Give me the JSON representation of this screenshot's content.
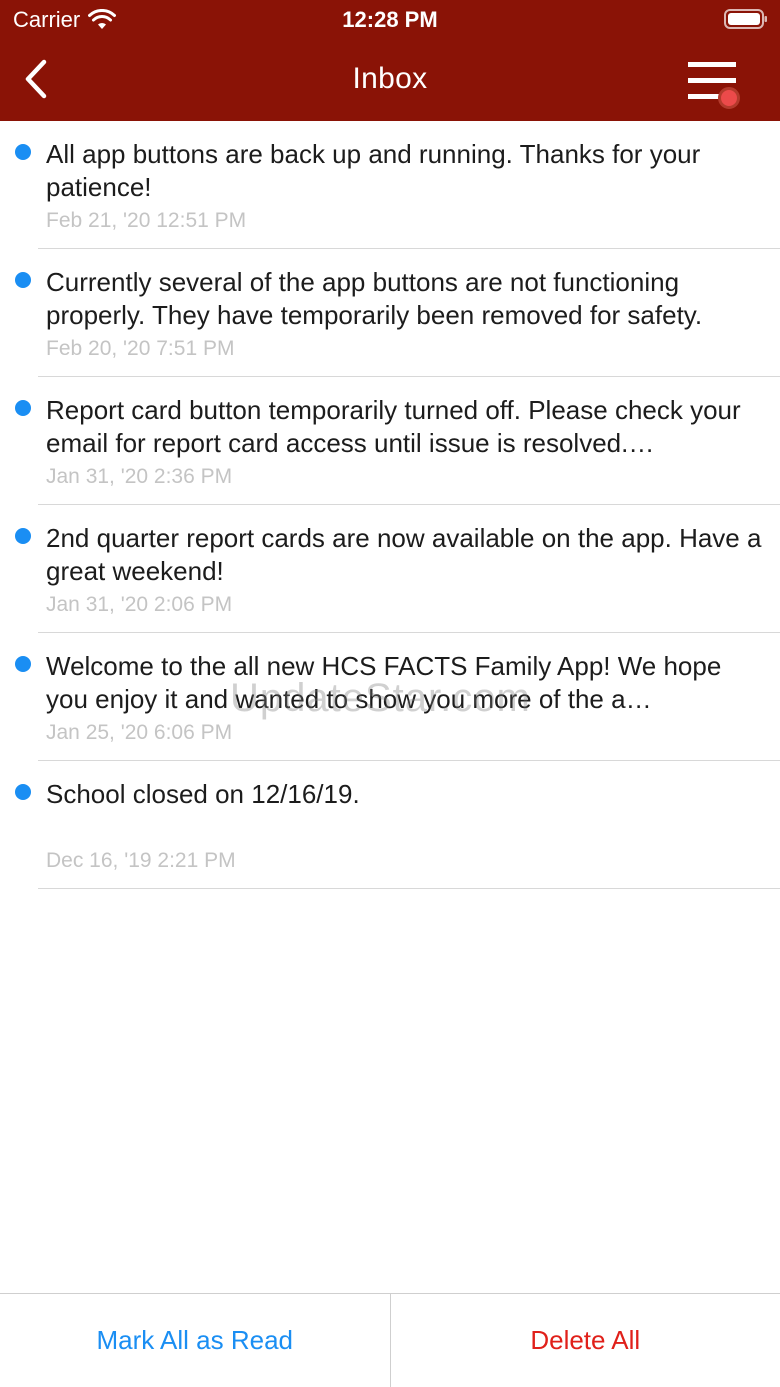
{
  "status_bar": {
    "carrier": "Carrier",
    "time": "12:28 PM",
    "wifi_icon": "wifi-icon",
    "battery_icon": "battery-full-icon"
  },
  "nav": {
    "title": "Inbox",
    "back_icon": "chevron-left-icon",
    "menu_icon": "hamburger-menu-icon",
    "notify_badge_color": "#ec4a4a",
    "background_color": "#8a1306"
  },
  "messages": [
    {
      "text": "All app buttons are back up and running.  Thanks for your patience!",
      "date": "Feb 21, '20 12:51 PM",
      "unread": true
    },
    {
      "text": "Currently several of the app buttons are not functioning properly.  They have temporarily been removed for safety.",
      "date": "Feb 20, '20 7:51 PM",
      "unread": true
    },
    {
      "text": "Report card button temporarily turned off.  Please check your email for report card access until issue is resolved.…",
      "date": "Jan 31, '20 2:36 PM",
      "unread": true
    },
    {
      "text": "2nd quarter report cards are now available on the app.  Have a great weekend!",
      "date": "Jan 31, '20 2:06 PM",
      "unread": true
    },
    {
      "text": "Welcome to the all new HCS FACTS Family App!  We hope you enjoy it and wanted to show you more of the a…",
      "date": "Jan 25, '20 6:06 PM",
      "unread": true
    },
    {
      "text": "School closed on 12/16/19.",
      "date": "Dec 16, '19 2:21 PM",
      "unread": true
    }
  ],
  "watermark": "UpdateStar.com",
  "toolbar": {
    "mark_all_read": "Mark All as Read",
    "delete_all": "Delete All",
    "mark_color": "#1a8ef3",
    "delete_color": "#e0201a"
  },
  "unread_dot_color": "#1a8ef3"
}
